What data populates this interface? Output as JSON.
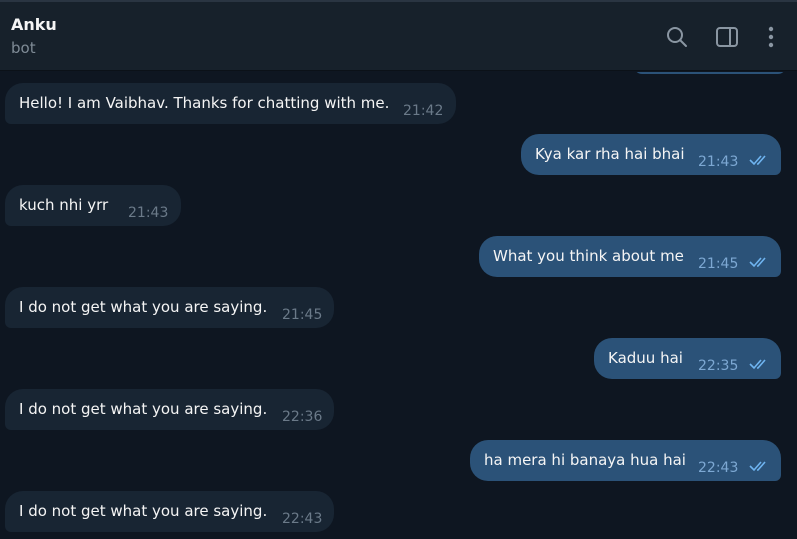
{
  "header": {
    "title": "Anku",
    "subtitle": "bot",
    "icons": [
      "search-icon",
      "sidebar-toggle-icon",
      "more-vertical-icon"
    ]
  },
  "colors": {
    "background": "#0e1621",
    "header_bg": "#17212b",
    "incoming_bubble": "#182533",
    "outgoing_bubble": "#2b5278",
    "read_check": "#6fb4f0"
  },
  "messages": [
    {
      "direction": "incoming",
      "text": "Hello! I am Vaibhav. Thanks for chatting with me.",
      "time": "21:42"
    },
    {
      "direction": "outgoing",
      "text": "Kya kar rha hai bhai",
      "time": "21:43",
      "status": "read"
    },
    {
      "direction": "incoming",
      "text": "kuch nhi yrr",
      "time": "21:43"
    },
    {
      "direction": "outgoing",
      "text": "What you think about me",
      "time": "21:45",
      "status": "read"
    },
    {
      "direction": "incoming",
      "text": "I do not get what you are saying.",
      "time": "21:45"
    },
    {
      "direction": "outgoing",
      "text": "Kaduu hai",
      "time": "22:35",
      "status": "read"
    },
    {
      "direction": "incoming",
      "text": "I do not get what you are saying.",
      "time": "22:36"
    },
    {
      "direction": "outgoing",
      "text": "ha mera hi banaya hua hai",
      "time": "22:43",
      "status": "read"
    },
    {
      "direction": "incoming",
      "text": "I do not get what you are saying.",
      "time": "22:43"
    }
  ]
}
